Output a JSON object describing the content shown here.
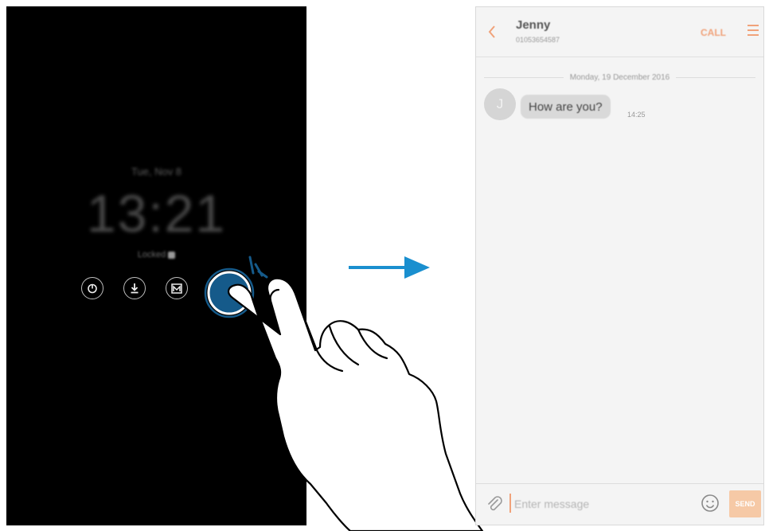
{
  "lock_screen": {
    "date": "Tue, Nov 8",
    "time": "13:21",
    "status": "Locked",
    "shortcut_icons": [
      "timer-icon",
      "download-icon",
      "gallery-icon",
      "message-icon"
    ]
  },
  "message_screen": {
    "contact_name": "Jenny",
    "contact_number": "01053654587",
    "call_label": "CALL",
    "date_separator": "Monday, 19 December 2016",
    "avatar_initial": "J",
    "message_text": "How are you?",
    "message_time": "14:25",
    "input_placeholder": "Enter message",
    "send_label": "SEND"
  },
  "colors": {
    "accent": "#f0a27a",
    "arrow": "#1a8fcf",
    "touch": "#155a8a"
  }
}
